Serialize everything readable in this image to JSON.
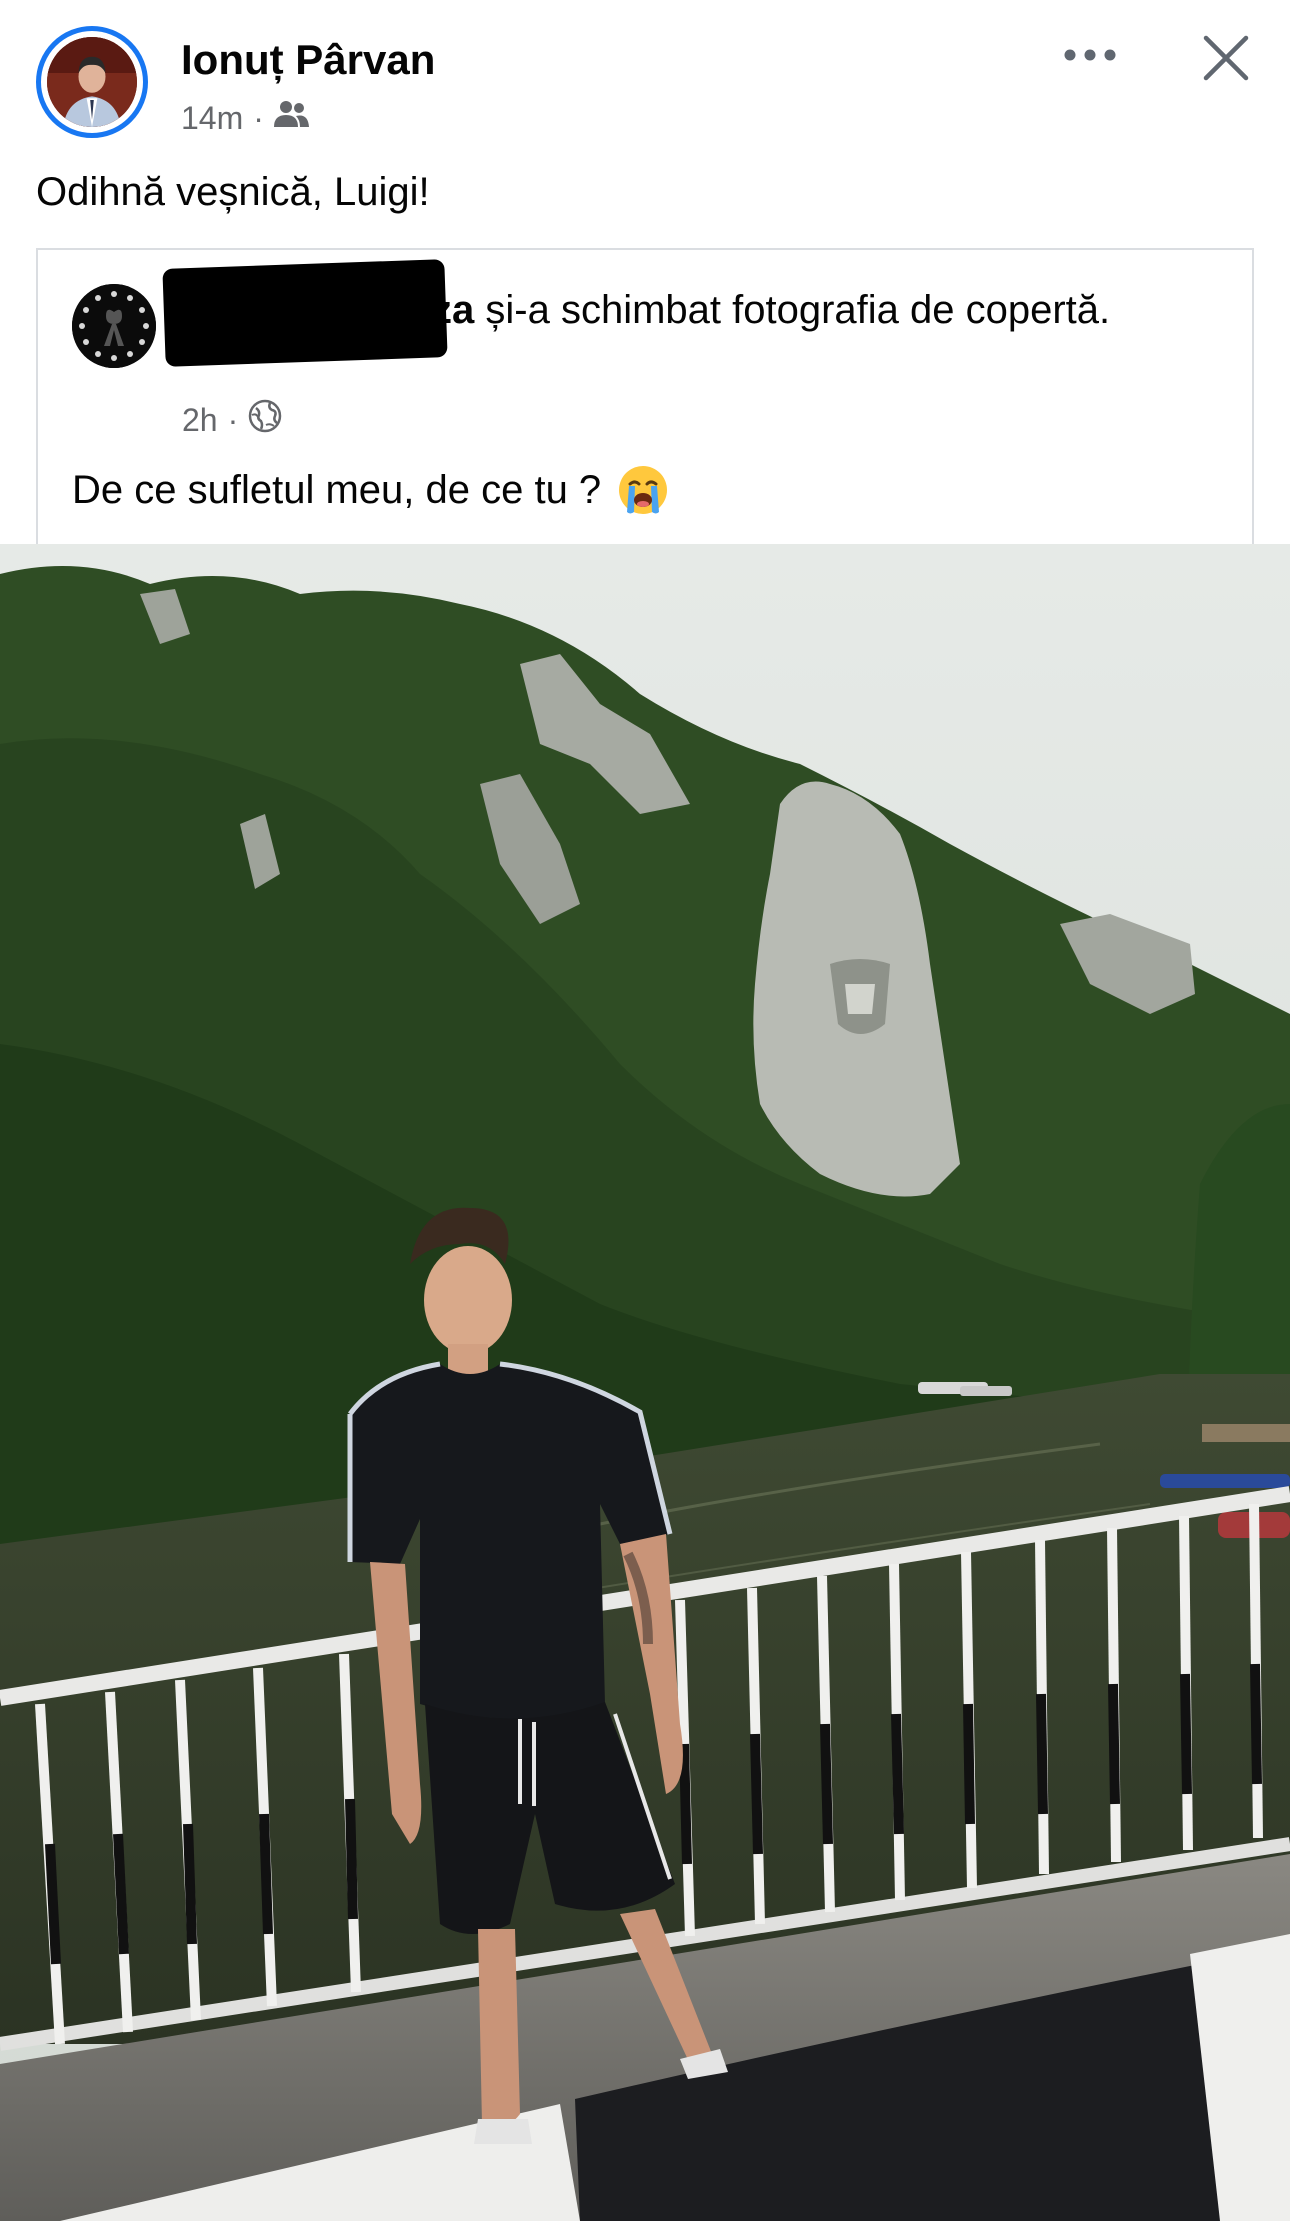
{
  "post": {
    "author": "Ionuț Pârvan",
    "time": "14m",
    "separator": "·",
    "audience_icon": "friends-icon",
    "caption": "Odihnă veșnică, Luigi!"
  },
  "shared": {
    "name_visible_fragment": "za",
    "action": "și-a schimbat fotografia de copertă.",
    "time": "2h",
    "separator": "·",
    "audience_icon": "globe-icon",
    "text": "De ce sufletul meu, de ce tu ?",
    "emoji": "loudly-crying-face"
  },
  "icons": {
    "more": "more-options-icon",
    "close": "close-icon"
  },
  "colors": {
    "accent": "#1877F2",
    "meta_text": "#65676B",
    "card_border": "#DADDE1"
  }
}
